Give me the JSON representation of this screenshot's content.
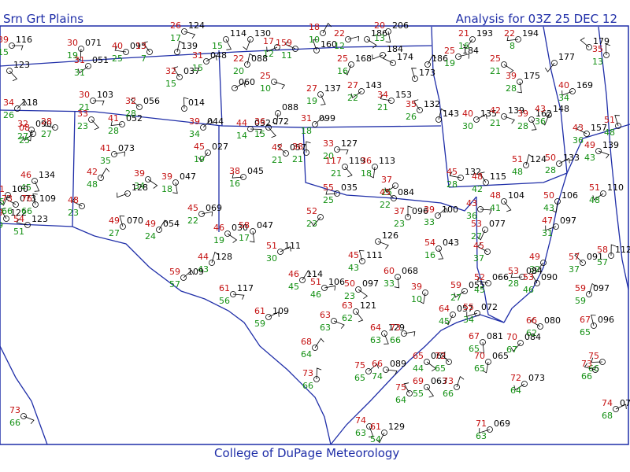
{
  "header": {
    "region": "Srn Grt Plains",
    "analysis": "Analysis for 03Z 25 DEC 12",
    "credit": "College of DuPage Meteorology"
  },
  "colors": {
    "background": "#ffffff",
    "frame": "#1f2ea8",
    "boundaries": "#1f2ea8",
    "temperature": "#c41010",
    "dewpoint": "#139013",
    "pressure": "#000000"
  },
  "stations": [
    {
      "t": "39",
      "d": "15",
      "p": "116"
    },
    {
      "t": "",
      "d": "",
      "p": "123"
    },
    {
      "t": "30",
      "d": "19",
      "p": "071"
    },
    {
      "t": "31",
      "d": "31",
      "p": "051"
    },
    {
      "t": "40",
      "d": "25",
      "p": "095"
    },
    {
      "t": "13",
      "d": "7",
      "p": ""
    },
    {
      "t": "",
      "d": "",
      "p": "139"
    },
    {
      "t": "31",
      "d": "15",
      "p": "048"
    },
    {
      "t": "26",
      "d": "17",
      "p": "124"
    },
    {
      "t": "",
      "d": "15",
      "p": "114"
    },
    {
      "t": "",
      "d": "",
      "p": "130"
    },
    {
      "t": "17",
      "d": "12",
      "p": ""
    },
    {
      "t": "159",
      "d": "11",
      "p": ""
    },
    {
      "t": "",
      "d": "",
      "p": "160"
    },
    {
      "t": "18",
      "d": "10",
      "p": ""
    },
    {
      "t": "22",
      "d": "12",
      "p": ""
    },
    {
      "t": "",
      "d": "",
      "p": "186"
    },
    {
      "t": "20",
      "d": "13",
      "p": "206"
    },
    {
      "t": "21",
      "d": "16",
      "p": "193"
    },
    {
      "t": "22",
      "d": "8",
      "p": "194"
    },
    {
      "t": "",
      "d": "",
      "p": "179"
    },
    {
      "t": "35",
      "d": "13",
      "p": ""
    },
    {
      "t": "34",
      "d": "26",
      "p": "118"
    },
    {
      "t": "30",
      "d": "21",
      "p": "103"
    },
    {
      "t": "33",
      "d": "23",
      "p": ""
    },
    {
      "t": "32",
      "d": "27",
      "p": "090"
    },
    {
      "t": "08",
      "d": "25",
      "p": ""
    },
    {
      "t": "28",
      "d": "27",
      "p": ""
    },
    {
      "t": "32",
      "d": "15",
      "p": "037"
    },
    {
      "t": "22",
      "d": "20",
      "p": "088"
    },
    {
      "t": "",
      "d": "",
      "p": "060"
    },
    {
      "t": "25",
      "d": "10",
      "p": ""
    },
    {
      "t": "27",
      "d": "19",
      "p": "137"
    },
    {
      "t": "25",
      "d": "16",
      "p": "168"
    },
    {
      "t": "",
      "d": "",
      "p": "184"
    },
    {
      "t": "",
      "d": "",
      "p": "174"
    },
    {
      "t": "",
      "d": "",
      "p": "173"
    },
    {
      "t": "",
      "d": "",
      "p": "186"
    },
    {
      "t": "25",
      "d": "19",
      "p": "184"
    },
    {
      "t": "25",
      "d": "21",
      "p": ""
    },
    {
      "t": "39",
      "d": "28",
      "p": "175"
    },
    {
      "t": "",
      "d": "",
      "p": "177"
    },
    {
      "t": "41",
      "d": "28",
      "p": "052"
    },
    {
      "t": "32",
      "d": "28",
      "p": "056"
    },
    {
      "t": "",
      "d": "",
      "p": "014"
    },
    {
      "t": "39",
      "d": "34",
      "p": "044"
    },
    {
      "t": "44",
      "d": "14",
      "p": "032"
    },
    {
      "t": "36",
      "d": "15",
      "p": "072"
    },
    {
      "t": "",
      "d": "",
      "p": "088"
    },
    {
      "t": "27",
      "d": "22",
      "p": "143"
    },
    {
      "t": "34",
      "d": "21",
      "p": "153"
    },
    {
      "t": "35",
      "d": "26",
      "p": "132"
    },
    {
      "t": "",
      "d": "",
      "p": "143"
    },
    {
      "t": "40",
      "d": "30",
      "p": "135"
    },
    {
      "t": "42",
      "d": "21",
      "p": "139"
    },
    {
      "t": "39",
      "d": "28",
      "p": "162"
    },
    {
      "t": "43",
      "d": "36",
      "p": "148"
    },
    {
      "t": "40",
      "d": "34",
      "p": "169"
    },
    {
      "t": "43",
      "d": "36",
      "p": "157"
    },
    {
      "t": "51",
      "d": "48",
      "p": ""
    },
    {
      "t": "42",
      "d": "48",
      "p": ""
    },
    {
      "t": "41",
      "d": "35",
      "p": "073"
    },
    {
      "t": "39",
      "d": "34",
      "p": ""
    },
    {
      "t": "39",
      "d": "18",
      "p": "047"
    },
    {
      "t": "45",
      "d": "19",
      "p": "027"
    },
    {
      "t": "38",
      "d": "16",
      "p": "045"
    },
    {
      "t": "42",
      "d": "21",
      "p": "057"
    },
    {
      "t": "38",
      "d": "21",
      "p": ""
    },
    {
      "t": "31",
      "d": "18",
      "p": "099"
    },
    {
      "t": "33",
      "d": "20",
      "p": "127"
    },
    {
      "t": "117",
      "d": "21",
      "p": "119"
    },
    {
      "t": "36",
      "d": "18",
      "p": "113"
    },
    {
      "t": "37",
      "d": "25",
      "p": ""
    },
    {
      "t": "45",
      "d": "28",
      "p": "132"
    },
    {
      "t": "48",
      "d": "42",
      "p": "115"
    },
    {
      "t": "51",
      "d": "48",
      "p": "124"
    },
    {
      "t": "50",
      "d": "28",
      "p": "133"
    },
    {
      "t": "49",
      "d": "43",
      "p": "139"
    },
    {
      "t": "46",
      "d": "45",
      "p": "134"
    },
    {
      "t": "51",
      "d": "35",
      "p": "100"
    },
    {
      "t": "",
      "d": "",
      "p": "128"
    },
    {
      "t": "48",
      "d": "23",
      "p": ""
    },
    {
      "t": "49",
      "d": "27",
      "p": "070"
    },
    {
      "t": "49",
      "d": "24",
      "p": "054"
    },
    {
      "t": "45",
      "d": "22",
      "p": "069"
    },
    {
      "t": "46",
      "d": "19",
      "p": "030"
    },
    {
      "t": "58",
      "d": "17",
      "p": "047"
    },
    {
      "t": "52",
      "d": "23",
      "p": ""
    },
    {
      "t": "55",
      "d": "25",
      "p": "035"
    },
    {
      "t": "45",
      "d": "22",
      "p": "084"
    },
    {
      "t": "37",
      "d": "23",
      "p": "096"
    },
    {
      "t": "39",
      "d": "33",
      "p": "100"
    },
    {
      "t": "43",
      "d": "36",
      "p": ""
    },
    {
      "t": "48",
      "d": "41",
      "p": "104"
    },
    {
      "t": "50",
      "d": "43",
      "p": "106"
    },
    {
      "t": "51",
      "d": "48",
      "p": "110"
    },
    {
      "t": "54",
      "d": "51",
      "p": "123"
    },
    {
      "t": "49",
      "d": "49",
      "p": "122"
    },
    {
      "t": "44",
      "d": "43",
      "p": "128"
    },
    {
      "t": "51",
      "d": "30",
      "p": "111"
    },
    {
      "t": "",
      "d": "",
      "p": "126"
    },
    {
      "t": "54",
      "d": "16",
      "p": "043"
    },
    {
      "t": "53",
      "d": "27",
      "p": "077"
    },
    {
      "t": "47",
      "d": "31",
      "p": "097"
    },
    {
      "t": "45",
      "d": "37",
      "p": ""
    },
    {
      "t": "45",
      "d": "43",
      "p": "111"
    },
    {
      "t": "46",
      "d": "45",
      "p": "114"
    },
    {
      "t": "51",
      "d": "46",
      "p": "106"
    },
    {
      "t": "50",
      "d": "23",
      "p": "097"
    },
    {
      "t": "60",
      "d": "33",
      "p": "068"
    },
    {
      "t": "49",
      "d": "32",
      "p": ""
    },
    {
      "t": "53",
      "d": "28",
      "p": "084"
    },
    {
      "t": "57",
      "d": "37",
      "p": "091"
    },
    {
      "t": "58",
      "d": "57",
      "p": "112"
    },
    {
      "t": "59",
      "d": "57",
      "p": "109"
    },
    {
      "t": "61",
      "d": "56",
      "p": "117"
    },
    {
      "t": "63",
      "d": "62",
      "p": "121"
    },
    {
      "t": "39",
      "d": "10",
      "p": ""
    },
    {
      "t": "59",
      "d": "27",
      "p": "055"
    },
    {
      "t": "52",
      "d": "45",
      "p": "066"
    },
    {
      "t": "53",
      "d": "46",
      "p": "090"
    },
    {
      "t": "59",
      "d": "59",
      "p": "097"
    },
    {
      "t": "61",
      "d": "59",
      "p": "109"
    },
    {
      "t": "63",
      "d": "63",
      "p": ""
    },
    {
      "t": "64",
      "d": "63",
      "p": "129"
    },
    {
      "t": "64",
      "d": "45",
      "p": "057"
    },
    {
      "t": "55",
      "d": "34",
      "p": "072"
    },
    {
      "t": "66",
      "d": "62",
      "p": "080"
    },
    {
      "t": "67",
      "d": "65",
      "p": "096"
    },
    {
      "t": "68",
      "d": "64",
      "p": ""
    },
    {
      "t": "73",
      "d": "66",
      "p": ""
    },
    {
      "t": "65",
      "d": "44",
      "p": "061"
    },
    {
      "t": "67",
      "d": "65",
      "p": "081"
    },
    {
      "t": "70",
      "d": "67",
      "p": "084"
    },
    {
      "t": "75",
      "d": "66",
      "p": ""
    },
    {
      "t": "72",
      "d": "65",
      "p": ""
    },
    {
      "t": "73",
      "d": "66",
      "p": ""
    },
    {
      "t": "75",
      "d": "65",
      "p": ""
    },
    {
      "t": "66",
      "d": "74",
      "p": "089"
    },
    {
      "t": "69",
      "d": "55",
      "p": "063"
    },
    {
      "t": "70",
      "d": "65",
      "p": "065"
    },
    {
      "t": "72",
      "d": "64",
      "p": "073"
    },
    {
      "t": "73",
      "d": "66",
      "p": ""
    },
    {
      "t": "75",
      "d": "64",
      "p": ""
    },
    {
      "t": "73",
      "d": "66",
      "p": ""
    },
    {
      "t": "74",
      "d": "68",
      "p": "078"
    },
    {
      "t": "73",
      "d": "66",
      "p": ""
    },
    {
      "t": "74",
      "d": "63",
      "p": ""
    },
    {
      "t": "61",
      "d": "54",
      "p": "129"
    },
    {
      "t": "71",
      "d": "63",
      "p": "069"
    },
    {
      "t": "73",
      "d": "66",
      "p": "073"
    },
    {
      "t": "76",
      "d": "66",
      "p": "109"
    }
  ]
}
